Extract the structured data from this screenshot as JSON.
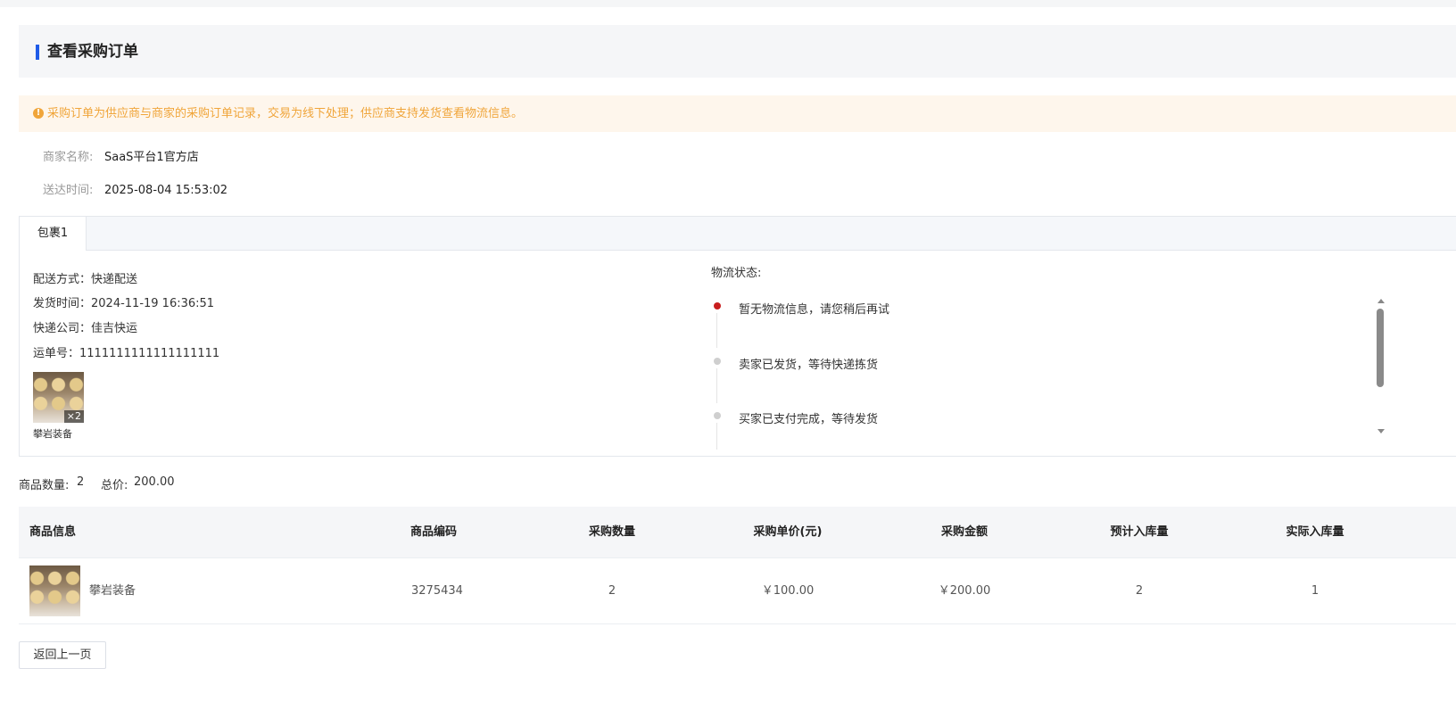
{
  "page_title": "查看采购订单",
  "notice": {
    "icon": "warning-icon",
    "text": "采购订单为供应商与商家的采购订单记录，交易为线下处理；供应商支持发货查看物流信息。",
    "color": "#f0a53a"
  },
  "merchant": {
    "name_label": "商家名称:",
    "name_value": "SaaS平台1官方店",
    "time_label": "送达时间:",
    "time_value": "2025-08-04 15:53:02"
  },
  "package": {
    "tab_label": "包裹1",
    "delivery_method": "配送方式：快递配送",
    "ship_time": "发货时间：2024-11-19 16:36:51",
    "courier": "快递公司：佳吉快运",
    "tracking_no": "运单号：1111111111111111111",
    "thumb_count": "×2",
    "thumb_caption": "攀岩装备",
    "logistics_label": "物流状态:",
    "timeline": [
      {
        "text": "暂无物流信息，请您稍后再试",
        "current": true
      },
      {
        "text": "卖家已发货，等待快递拣货",
        "current": false
      },
      {
        "text": "买家已支付完成，等待发货",
        "current": false
      }
    ],
    "current_color": "#c81e1e"
  },
  "summary": {
    "qty_label": "商品数量:",
    "qty_value": "2",
    "total_label": "总价:",
    "total_value": "200.00"
  },
  "table": {
    "headers": [
      "商品信息",
      "商品编码",
      "采购数量",
      "采购单价(元)",
      "采购金额",
      "预计入库量",
      "实际入库量"
    ],
    "rows": [
      {
        "name": "攀岩装备",
        "code": "3275434",
        "qty": "2",
        "unit_price": "￥100.00",
        "amount": "￥200.00",
        "expected_in": "2",
        "actual_in": "1"
      }
    ]
  },
  "back_button": "返回上一页",
  "accent_color": "#1f5be8"
}
